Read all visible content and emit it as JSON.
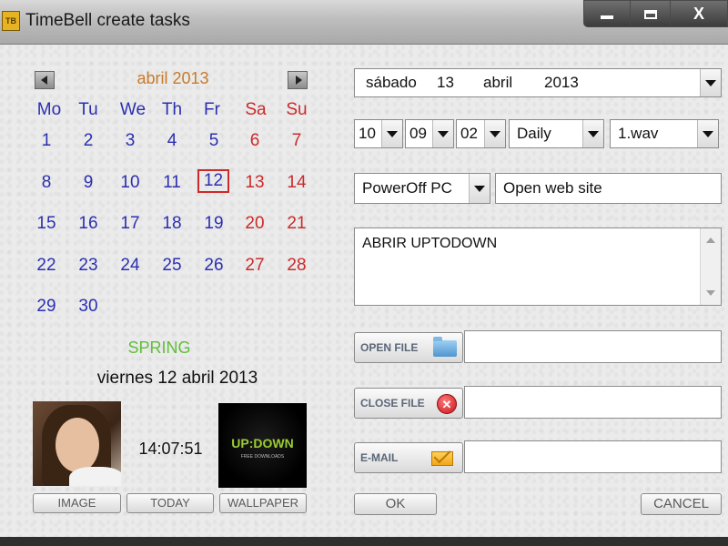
{
  "window": {
    "icon_text": "TB",
    "title": "TimeBell create tasks",
    "controls": {
      "minimize": "",
      "maximize": "",
      "close": "X"
    }
  },
  "calendar": {
    "month_title": "abril 2013",
    "weekdays": [
      "Mo",
      "Tu",
      "We",
      "Th",
      "Fr",
      "Sa",
      "Su"
    ],
    "weeks": [
      [
        "1",
        "2",
        "3",
        "4",
        "5",
        "6",
        "7"
      ],
      [
        "8",
        "9",
        "10",
        "11",
        "12",
        "13",
        "14"
      ],
      [
        "15",
        "16",
        "17",
        "18",
        "19",
        "20",
        "21"
      ],
      [
        "22",
        "23",
        "24",
        "25",
        "26",
        "27",
        "28"
      ],
      [
        "29",
        "30",
        "",
        "",
        "",
        "",
        ""
      ]
    ],
    "selected_day": "12",
    "colors": {
      "weekday": "#2b2fb0",
      "weekend": "#cc2a2a",
      "month": "#c77a2a"
    }
  },
  "info": {
    "season": "SPRING",
    "season_color": "#5fbf3a",
    "full_date": "viernes 12 abril 2013",
    "clock": "14:07:51",
    "wallpaper_logo": "UP:DOWN",
    "wallpaper_tag": "FREE DOWNLOADS"
  },
  "left_buttons": {
    "image": "IMAGE",
    "today": "TODAY",
    "wallpaper": "WALLPAPER"
  },
  "form": {
    "date_combo": {
      "weekday": "sábado",
      "day": "13",
      "month": "abril",
      "year": "2013"
    },
    "hour": "10",
    "minute": "09",
    "second": "02",
    "repeat": "Daily",
    "sound": "1.wav",
    "action_type": "PowerOff PC",
    "action_value": "Open web site",
    "message": "ABRIR UPTODOWN",
    "open_file_label": "OPEN FILE",
    "open_file_value": "",
    "close_file_label": "CLOSE FILE",
    "close_file_value": "",
    "email_label": "E-MAIL",
    "email_value": "",
    "close_icon_glyph": "✕"
  },
  "dialog_buttons": {
    "ok": "OK",
    "cancel": "CANCEL"
  }
}
